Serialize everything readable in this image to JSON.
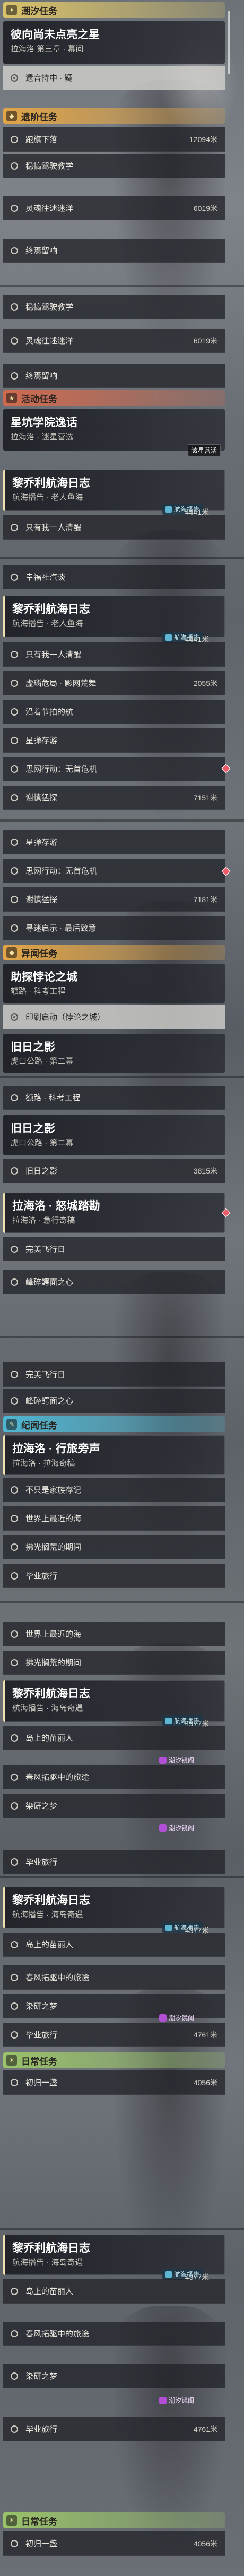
{
  "labels": {
    "cat_chaoxi": "潮汐任务",
    "cat_tiandi": "遗阶任务",
    "cat_huodong": "活动任务",
    "cat_yiwen": "异闻任务",
    "cat_jiyuan": "纪闻任务",
    "cat_richang": "日常任务"
  },
  "s1": {
    "card_title": "彼向尚未点亮之星",
    "card_sub": "拉海洛 第三章 · 幕间",
    "row_sel": "遗音持中 · 疑",
    "rows": [
      "跑旗下落",
      "稳搞驾驶教学",
      "灵魂往述迷洋",
      "终焉留响"
    ],
    "dist1": "12094米",
    "dist2": "6019米"
  },
  "s2": {
    "rows": [
      "稳搞驾驶教学",
      "灵魂往述迷洋",
      "终焉留响"
    ],
    "dist": "6019米",
    "act_title": "星坑学院逸话",
    "act_sub": "拉海洛 · 迷星营选",
    "act_btn": "该星营活",
    "card2_title": "黎乔利航海日志",
    "card2_sub": "航海播告 · 老人鱼海",
    "tag": "航海播告",
    "row": "只有我一人清醒",
    "dist3": "4441米"
  },
  "s3": {
    "row_a": "幸福社汽谈",
    "card_title": "黎乔利航海日志",
    "card_sub": "航海播告 · 老人鱼海",
    "tag": "航海播告",
    "rows": [
      "只有我一人清醒",
      "虚瑙危局 · 影网荒舞",
      "沿着节拍的航",
      "星弹存游",
      "思网行动：无首危机",
      "谢慎猛探"
    ],
    "dist1": "4441米",
    "dist2": "2055米",
    "dist3": "7151米"
  },
  "s4": {
    "rows": [
      "星弹存游",
      "思网行动：无首危机",
      "谢慎猛探",
      "寻迷启示 · 最后致意"
    ],
    "dist": "7181米",
    "card_title": "助探悖论之城",
    "card_sub": "额路 · 科考工程",
    "row_sel": "印刷启动（悖论之城）",
    "card2_title": "旧日之影",
    "card2_sub": "虎口公路 · 第二幕"
  },
  "s5": {
    "row_a": "额路 · 科考工程",
    "card_title": "旧日之影",
    "card_sub": "虎口公路 · 第二幕",
    "row": "旧日之影",
    "dist": "3815米",
    "card2_title": "拉海洛 · 怒城踏勘",
    "card2_sub": "拉海洛 · 急行奇稿",
    "rows": [
      "完美飞行日",
      "峰碎鳄面之心"
    ]
  },
  "s6": {
    "rows": [
      "完美飞行日",
      "峰碎鳄面之心"
    ],
    "card_title": "拉海洛 · 行旅旁声",
    "card_sub": "拉海洛 · 拉海奇稿",
    "rows2": [
      "不只是家族存记",
      "世界上最近的海",
      "拂光搁荒的期间",
      "毕业旅行"
    ]
  },
  "s7": {
    "row_a": "世界上最近的海",
    "row_b": "拂光搁荒的期间",
    "card_title": "黎乔利航海日志",
    "card_sub": "航海播告 · 海岛奇遇",
    "tag": "航海播告",
    "rows": [
      "岛上的苗丽人",
      "春风拓驱中的旅途",
      "染研之梦"
    ],
    "dist1": "4377米",
    "badge": "潮汐镜阁",
    "row_c": "毕业旅行"
  },
  "s8": {
    "card_title": "黎乔利航海日志",
    "card_sub": "航海播告 · 海岛奇遇",
    "tag": "航海播告",
    "rows": [
      "岛上的苗丽人",
      "春风拓驱中的旅途",
      "染研之梦",
      "毕业旅行"
    ],
    "dist1": "4377米",
    "dist2": "4761米",
    "badge": "潮汐镜阁",
    "cat_row": "初归一盏",
    "dist3": "4056米"
  },
  "s9": {
    "card_title": "黎乔利航海日志",
    "card_sub": "航海播告 · 海岛奇遇",
    "tag": "航海播告",
    "rows": [
      "岛上的苗丽人",
      "春风拓驱中的旅途",
      "染研之梦",
      "毕业旅行"
    ],
    "dist1": "4377米",
    "dist2": "4761米",
    "badge": "潮汐镜阁",
    "cat_row": "初归一盏",
    "dist3": "4056米"
  }
}
